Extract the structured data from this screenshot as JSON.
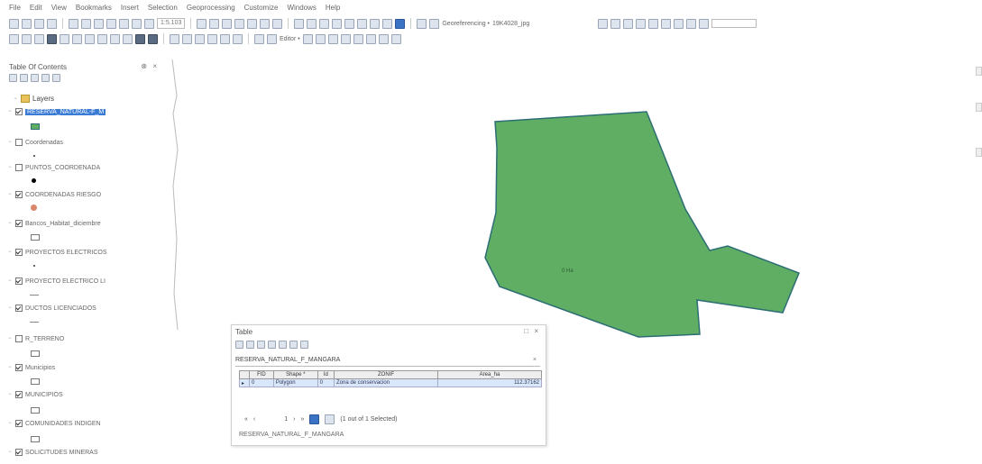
{
  "menu": [
    "File",
    "Edit",
    "View",
    "Bookmarks",
    "Insert",
    "Selection",
    "Geoprocessing",
    "Customize",
    "Windows",
    "Help"
  ],
  "toolbar": {
    "scale_value": "1:5.103",
    "georef_label": "Georeferencing •",
    "georef_layer": "19K4028_jpg",
    "editor_label": "Editor •"
  },
  "toc": {
    "title": "Table Of Contents",
    "controls": "⊗ ×",
    "root_label": "Layers",
    "layers": [
      {
        "name": "RESERVA_NATURAL-F_M",
        "checked": true,
        "selected": true,
        "symbol": "green-rect"
      },
      {
        "name": "Coordenadas",
        "checked": false,
        "selected": false,
        "symbol": "dot"
      },
      {
        "name": "PUNTOS_COORDENADA",
        "checked": false,
        "selected": false,
        "symbol": "black-dot"
      },
      {
        "name": "COORDENADAS RIESGO",
        "checked": true,
        "selected": false,
        "symbol": "red-circle"
      },
      {
        "name": "Bancos_Habitat_diciembre",
        "checked": true,
        "selected": false,
        "symbol": "empty-rect"
      },
      {
        "name": "PROYECTOS ELECTRICOS",
        "checked": true,
        "selected": false,
        "symbol": "dot"
      },
      {
        "name": "PROYECTO ELECTRICO LI",
        "checked": true,
        "selected": false,
        "symbol": "line"
      },
      {
        "name": "DUCTOS LICENCIADOS",
        "checked": true,
        "selected": false,
        "symbol": "line"
      },
      {
        "name": "R_TERRENO",
        "checked": false,
        "selected": false,
        "symbol": "empty-rect"
      },
      {
        "name": "Municipios",
        "checked": true,
        "selected": false,
        "symbol": "empty-rect"
      },
      {
        "name": "MUNICIPIOS",
        "checked": true,
        "selected": false,
        "symbol": "empty-rect"
      },
      {
        "name": "COMUNIDADES INDIGEN",
        "checked": true,
        "selected": false,
        "symbol": "empty-rect"
      },
      {
        "name": "SOLICITUDES MINERAS",
        "checked": true,
        "selected": false,
        "symbol": "line"
      }
    ]
  },
  "map": {
    "polygon_fill": "#5fae64",
    "polygon_stroke": "#2c6e74",
    "polygon_label": "0 Ha"
  },
  "table": {
    "title": "Table",
    "controls": "□ ×",
    "tab_name": "RESERVA_NATURAL_F_MANGARA",
    "tab_close": "×",
    "columns": [
      "FID",
      "Shape *",
      "Id",
      "ZONIF",
      "Area_ha"
    ],
    "rows": [
      {
        "fid": "0",
        "shape": "Polygon",
        "id": "0",
        "zonif": "Zona de conservacion",
        "area": "112.37162"
      }
    ],
    "nav_first": "«",
    "nav_prev": "‹",
    "record": "1",
    "nav_next": "›",
    "nav_last": "»",
    "selection_status": "(1 out of 1 Selected)",
    "footer_name": "RESERVA_NATURAL_F_MANGARA"
  }
}
